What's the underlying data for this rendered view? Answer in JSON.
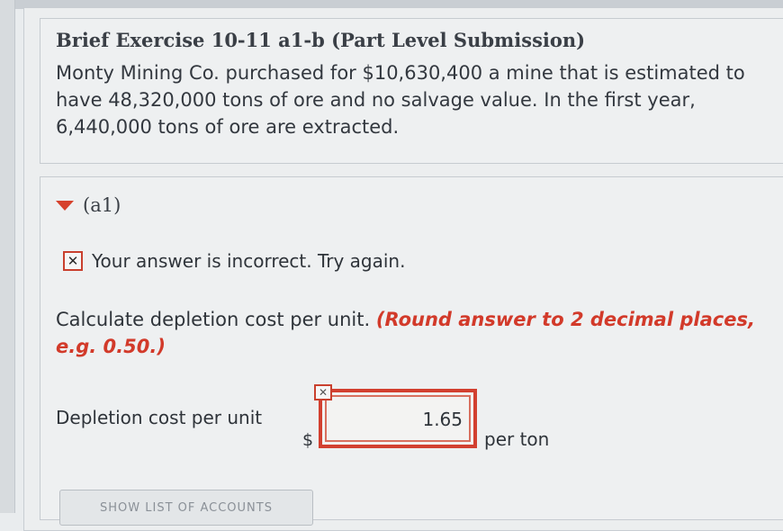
{
  "exercise": {
    "title": "Brief Exercise 10-11 a1-b (Part Level Submission)",
    "problem_text": "Monty Mining Co. purchased for $10,630,400 a mine that is estimated to have 48,320,000 tons of ore and no salvage value. In the first year, 6,440,000  tons of ore are extracted."
  },
  "section": {
    "label": "(a1)",
    "feedback": "Your answer is incorrect.  Try again.",
    "instruction": "Calculate depletion cost per unit.",
    "hint": "(Round answer to 2 decimal places, e.g. 0.50.)",
    "field_label": "Depletion cost per unit",
    "currency_symbol": "$",
    "answer_value": "1.65",
    "unit_label": "per ton",
    "show_accounts_button": "SHOW LIST OF ACCOUNTS"
  },
  "colors": {
    "error_red": "#d24030",
    "hint_red": "#d23a2a",
    "background": "#eceeef"
  },
  "icons": {
    "section_toggle": "triangle-down-icon",
    "error_marker": "x-box-icon"
  }
}
